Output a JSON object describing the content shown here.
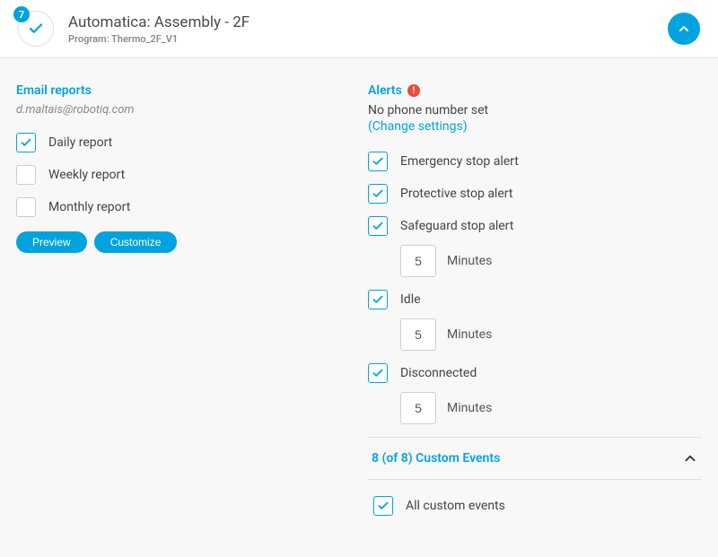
{
  "header": {
    "badge": "7",
    "title": "Automatica: Assembly - 2F",
    "subtitle": "Program: Thermo_2F_V1"
  },
  "emailReports": {
    "title": "Email reports",
    "email": "d.maltais@robotiq.com",
    "options": {
      "daily": {
        "label": "Daily report",
        "checked": true
      },
      "weekly": {
        "label": "Weekly report",
        "checked": false
      },
      "monthly": {
        "label": "Monthly report",
        "checked": false
      }
    },
    "buttons": {
      "preview": "Preview",
      "customize": "Customize"
    }
  },
  "alerts": {
    "title": "Alerts",
    "noPhone": "No phone number set",
    "changeLink": "(Change settings)",
    "items": {
      "emergency": {
        "label": "Emergency stop alert",
        "checked": true
      },
      "protective": {
        "label": "Protective stop alert",
        "checked": true
      },
      "safeguard": {
        "label": "Safeguard stop alert",
        "checked": true,
        "minutes": "5"
      },
      "idle": {
        "label": "Idle",
        "checked": true,
        "minutes": "5"
      },
      "disconnected": {
        "label": "Disconnected",
        "checked": true,
        "minutes": "5"
      }
    },
    "minutesLabel": "Minutes",
    "customEvents": {
      "title": "8 (of 8) Custom Events",
      "allLabel": "All custom events",
      "allChecked": true
    }
  }
}
